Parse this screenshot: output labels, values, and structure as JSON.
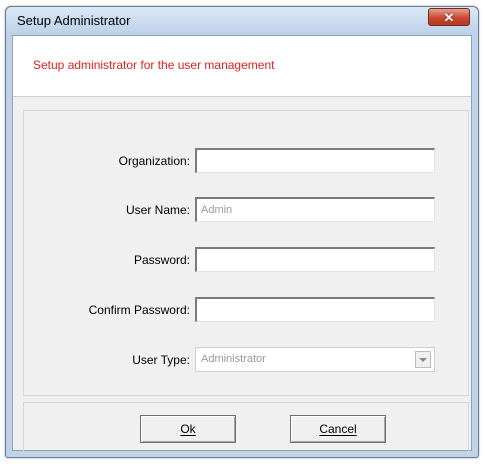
{
  "window": {
    "title": "Setup Administrator",
    "close_icon": "close-icon"
  },
  "header": {
    "message": "Setup administrator for the user management",
    "message_color": "#e02020"
  },
  "form": {
    "organization": {
      "label": "Organization:",
      "value": ""
    },
    "user_name": {
      "label": "User Name:",
      "value": "Admin"
    },
    "password": {
      "label": "Password:",
      "value": ""
    },
    "confirm_password": {
      "label": "Confirm Password:",
      "value": ""
    },
    "user_type": {
      "label": "User Type:",
      "selected": "Administrator",
      "icon": "chevron-down-icon"
    }
  },
  "buttons": {
    "ok_label": "Ok",
    "cancel_label": "Cancel"
  }
}
